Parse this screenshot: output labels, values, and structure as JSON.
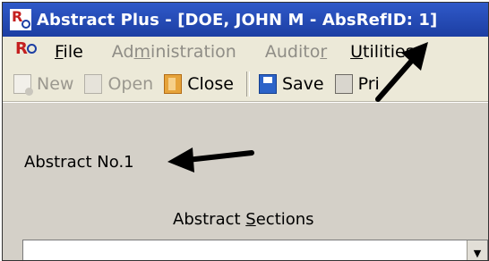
{
  "window": {
    "title": "Abstract Plus - [DOE, JOHN M - AbsRefID: 1]",
    "app_icon": "ro-logo-icon"
  },
  "menu": {
    "items": [
      {
        "label": "File",
        "underline": "F",
        "rest": "ile",
        "enabled": true
      },
      {
        "label_pre": "Ad",
        "underline": "m",
        "label_post": "inistration",
        "enabled": false
      },
      {
        "label_pre": "Audito",
        "underline": "r",
        "label_post": "",
        "enabled": false
      },
      {
        "label_pre": "",
        "underline": "U",
        "label_post": "tilities",
        "enabled": true
      }
    ]
  },
  "toolbar": {
    "new_label": "New",
    "open_label": "Open",
    "close_label": "Close",
    "save_label": "Save",
    "print_label": "Pri"
  },
  "main": {
    "abstract_no": "Abstract No.1",
    "sections_label_pre": "Abstract ",
    "sections_label_u": "S",
    "sections_label_post": "ections",
    "sections_value": ""
  },
  "colors": {
    "titlebar": "#1c3ea3",
    "logo_red": "#c41f1f",
    "annotation_arrow": "#000000"
  }
}
